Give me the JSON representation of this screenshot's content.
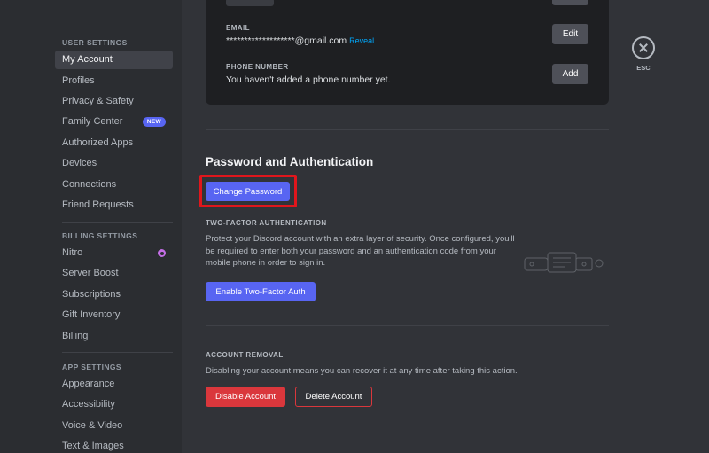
{
  "sidebar": {
    "user_settings_header": "USER SETTINGS",
    "user_items": [
      {
        "label": "My Account",
        "active": true
      },
      {
        "label": "Profiles"
      },
      {
        "label": "Privacy & Safety"
      },
      {
        "label": "Family Center",
        "badge": "NEW"
      },
      {
        "label": "Authorized Apps"
      },
      {
        "label": "Devices"
      },
      {
        "label": "Connections"
      },
      {
        "label": "Friend Requests"
      }
    ],
    "billing_settings_header": "BILLING SETTINGS",
    "billing_items": [
      {
        "label": "Nitro",
        "icon": "nitro-icon"
      },
      {
        "label": "Server Boost"
      },
      {
        "label": "Subscriptions"
      },
      {
        "label": "Gift Inventory"
      },
      {
        "label": "Billing"
      }
    ],
    "app_settings_header": "APP SETTINGS",
    "app_items": [
      {
        "label": "Appearance"
      },
      {
        "label": "Accessibility"
      },
      {
        "label": "Voice & Video"
      },
      {
        "label": "Text & Images"
      }
    ]
  },
  "account_card": {
    "email_label": "EMAIL",
    "email_value": "*******************@gmail.com",
    "reveal_label": "Reveal",
    "edit_label": "Edit",
    "phone_label": "PHONE NUMBER",
    "phone_value": "You haven't added a phone number yet.",
    "add_label": "Add"
  },
  "password_auth": {
    "title": "Password and Authentication",
    "change_password_label": "Change Password",
    "two_factor_header": "TWO-FACTOR AUTHENTICATION",
    "two_factor_desc_lines": [
      "Protect your Discord account with an extra layer of security. Once configured, you'll",
      "be required to enter both your password and an authentication code from your",
      "mobile phone in order to sign in."
    ],
    "enable_2fa_label": "Enable Two-Factor Auth"
  },
  "account_removal": {
    "header": "ACCOUNT REMOVAL",
    "desc": "Disabling your account means you can recover it at any time after taking this action.",
    "disable_label": "Disable Account",
    "delete_label": "Delete Account"
  },
  "esc": {
    "label": "ESC"
  },
  "colors": {
    "background": "#313338",
    "sidebar": "#2b2d31",
    "accent": "#5865f2",
    "danger": "#da373c",
    "highlight": "#e0161c",
    "link": "#00a8fc"
  }
}
